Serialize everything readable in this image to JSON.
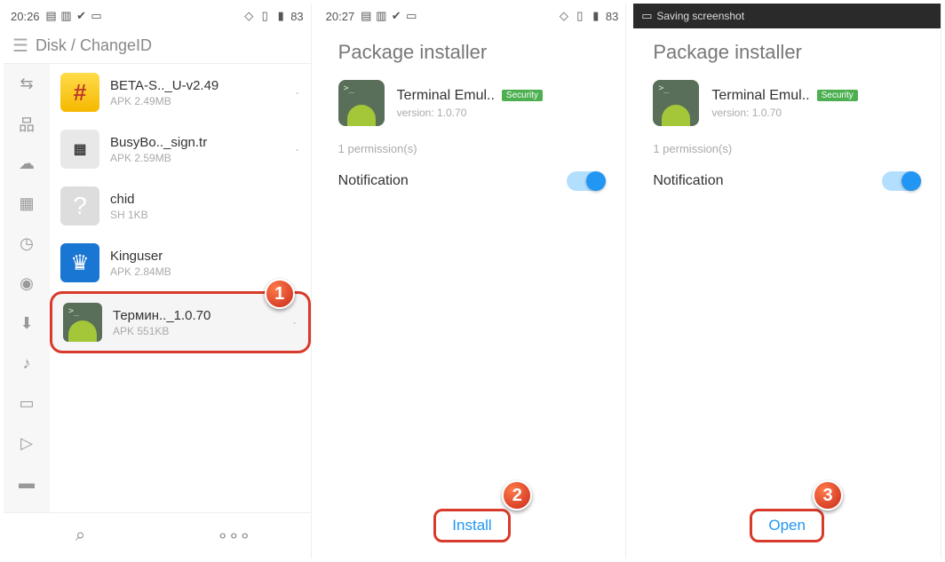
{
  "screen1": {
    "status": {
      "time": "20:26",
      "battery": "83"
    },
    "breadcrumb": "Disk / ChangeID",
    "files": [
      {
        "name": "BETA-S.._U-v2.49",
        "meta": "APK 2.49MB"
      },
      {
        "name": "BusyBo.._sign.tr",
        "meta": "APK 2.59MB"
      },
      {
        "name": "chid",
        "meta": "SH 1KB"
      },
      {
        "name": "Kinguser",
        "meta": "APK 2.84MB"
      },
      {
        "name": "Термин.._1.0.70",
        "meta": "APK 551KB"
      }
    ],
    "step": "1"
  },
  "screen2": {
    "status": {
      "time": "20:27",
      "battery": "83"
    },
    "header": "Package installer",
    "app_name": "Terminal Emul..",
    "badge": "Security",
    "version": "version: 1.0.70",
    "perm_count": "1 permission(s)",
    "perm_name": "Notification",
    "action": "Install",
    "step": "2"
  },
  "screen3": {
    "status": {
      "saving": "Saving screenshot"
    },
    "header": "Package installer",
    "app_name": "Terminal Emul..",
    "badge": "Security",
    "version": "version: 1.0.70",
    "perm_count": "1 permission(s)",
    "perm_name": "Notification",
    "action": "Open",
    "step": "3"
  }
}
